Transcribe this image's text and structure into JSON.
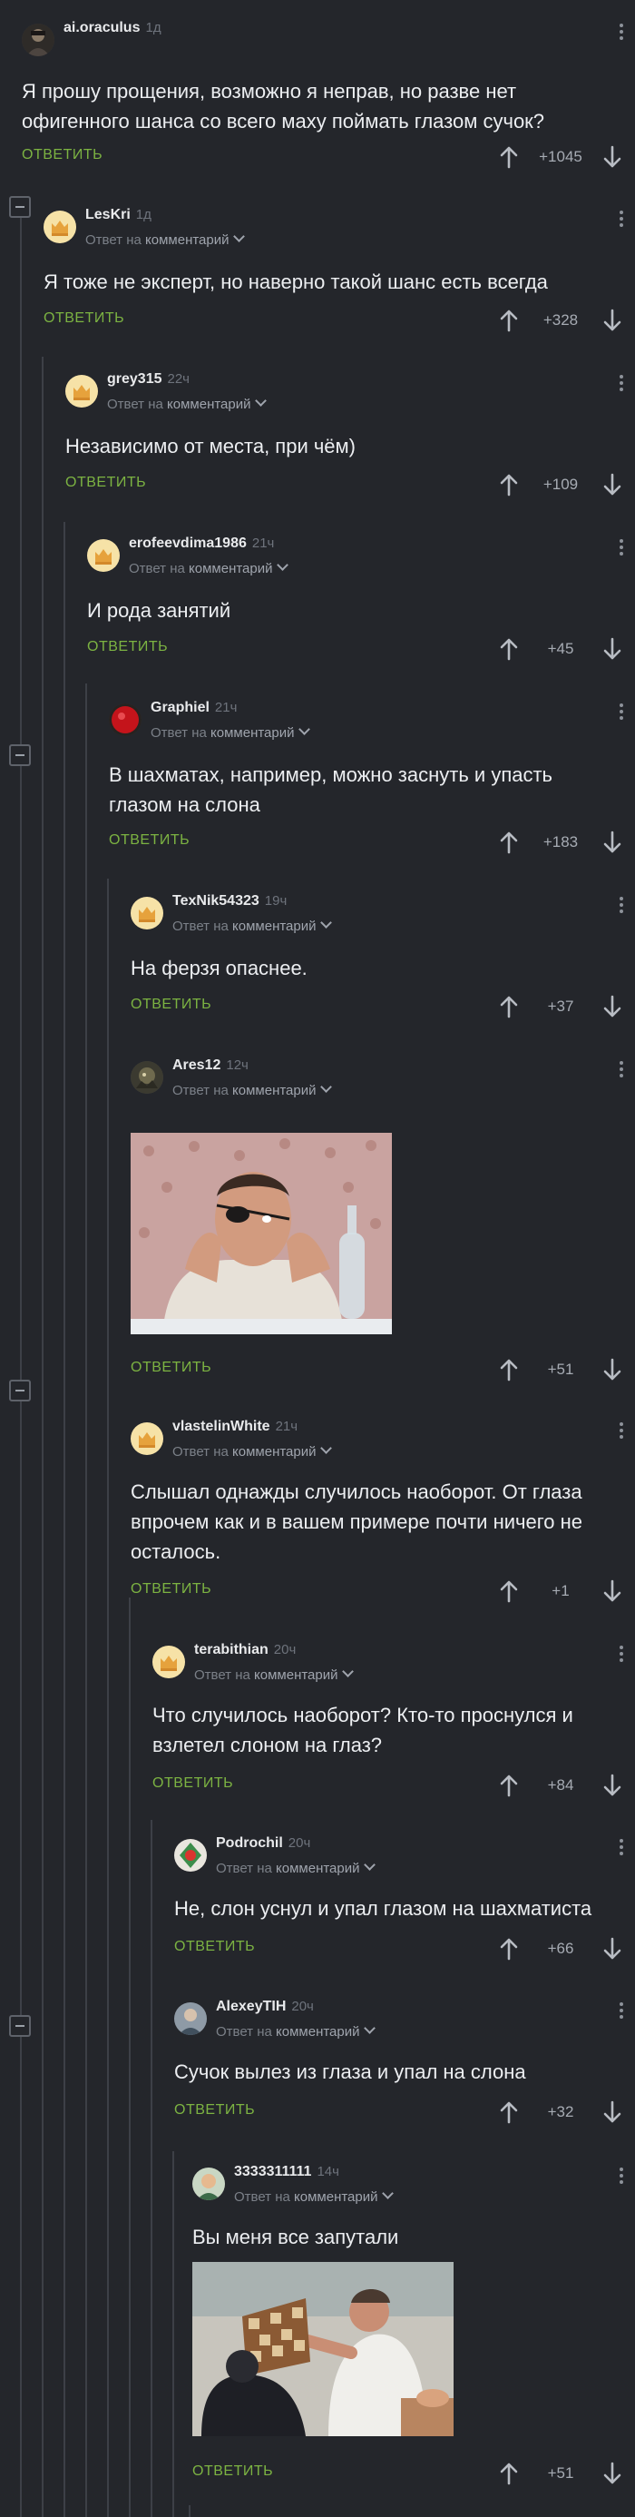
{
  "reply_label": "ОТВЕТИТЬ",
  "comments": [
    {
      "user": "ai.oraculus",
      "time": "1д",
      "reply_to": "",
      "reply_to_target": "",
      "text": "Я прошу прощения, возможно я неправ, но разве нет офигенного шанса со всего маху поймать глазом сучок?",
      "votes": "+1045"
    },
    {
      "user": "LesKri",
      "time": "1д",
      "reply_to": "Ответ на",
      "reply_to_target": "комментарий",
      "text": "Я тоже не эксперт, но наверно такой шанс есть всегда",
      "votes": "+328"
    },
    {
      "user": "grey315",
      "time": "22ч",
      "reply_to": "Ответ на",
      "reply_to_target": "комментарий",
      "text": "Независимо от места, при чём)",
      "votes": "+109"
    },
    {
      "user": "erofeevdima1986",
      "time": "21ч",
      "reply_to": "Ответ на",
      "reply_to_target": "комментарий",
      "text": "И рода занятий",
      "votes": "+45"
    },
    {
      "user": "Graphiel",
      "time": "21ч",
      "reply_to": "Ответ на",
      "reply_to_target": "комментарий",
      "text": "В шахматах, например, можно заснуть и упасть глазом на слона",
      "votes": "+183"
    },
    {
      "user": "TexNik54323",
      "time": "19ч",
      "reply_to": "Ответ на",
      "reply_to_target": "комментарий",
      "text": "На ферзя опаснее.",
      "votes": "+37"
    },
    {
      "user": "Ares12",
      "time": "12ч",
      "reply_to": "Ответ на",
      "reply_to_target": "комментарий",
      "text": "",
      "votes": "+51"
    },
    {
      "user": "vlastelinWhite",
      "time": "21ч",
      "reply_to": "Ответ на",
      "reply_to_target": "комментарий",
      "text": "Слышал однажды случилось наоборот. От глаза впрочем как и в вашем примере почти ничего не осталось.",
      "votes": "+1"
    },
    {
      "user": "terabithian",
      "time": "20ч",
      "reply_to": "Ответ на",
      "reply_to_target": "комментарий",
      "text": "Что случилось наоборот? Кто-то проснулся и взлетел слоном на глаз?",
      "votes": "+84"
    },
    {
      "user": "Podrochil",
      "time": "20ч",
      "reply_to": "Ответ на",
      "reply_to_target": "комментарий",
      "text": "Не, слон уснул и упал глазом на шахматиста",
      "votes": "+66"
    },
    {
      "user": "AlexeyTIH",
      "time": "20ч",
      "reply_to": "Ответ на",
      "reply_to_target": "комментарий",
      "text": "Сучок вылез из глаза и упал на слона",
      "votes": "+32"
    },
    {
      "user": "3333311111",
      "time": "14ч",
      "reply_to": "Ответ на",
      "reply_to_target": "комментарий",
      "text": "Вы меня все запутали",
      "votes": "+51"
    }
  ],
  "colors": {
    "background": "#24262b",
    "reply_green": "#7cb342",
    "thread_line": "#3d4047",
    "text": "#eceef1",
    "muted": "#7b8088"
  }
}
